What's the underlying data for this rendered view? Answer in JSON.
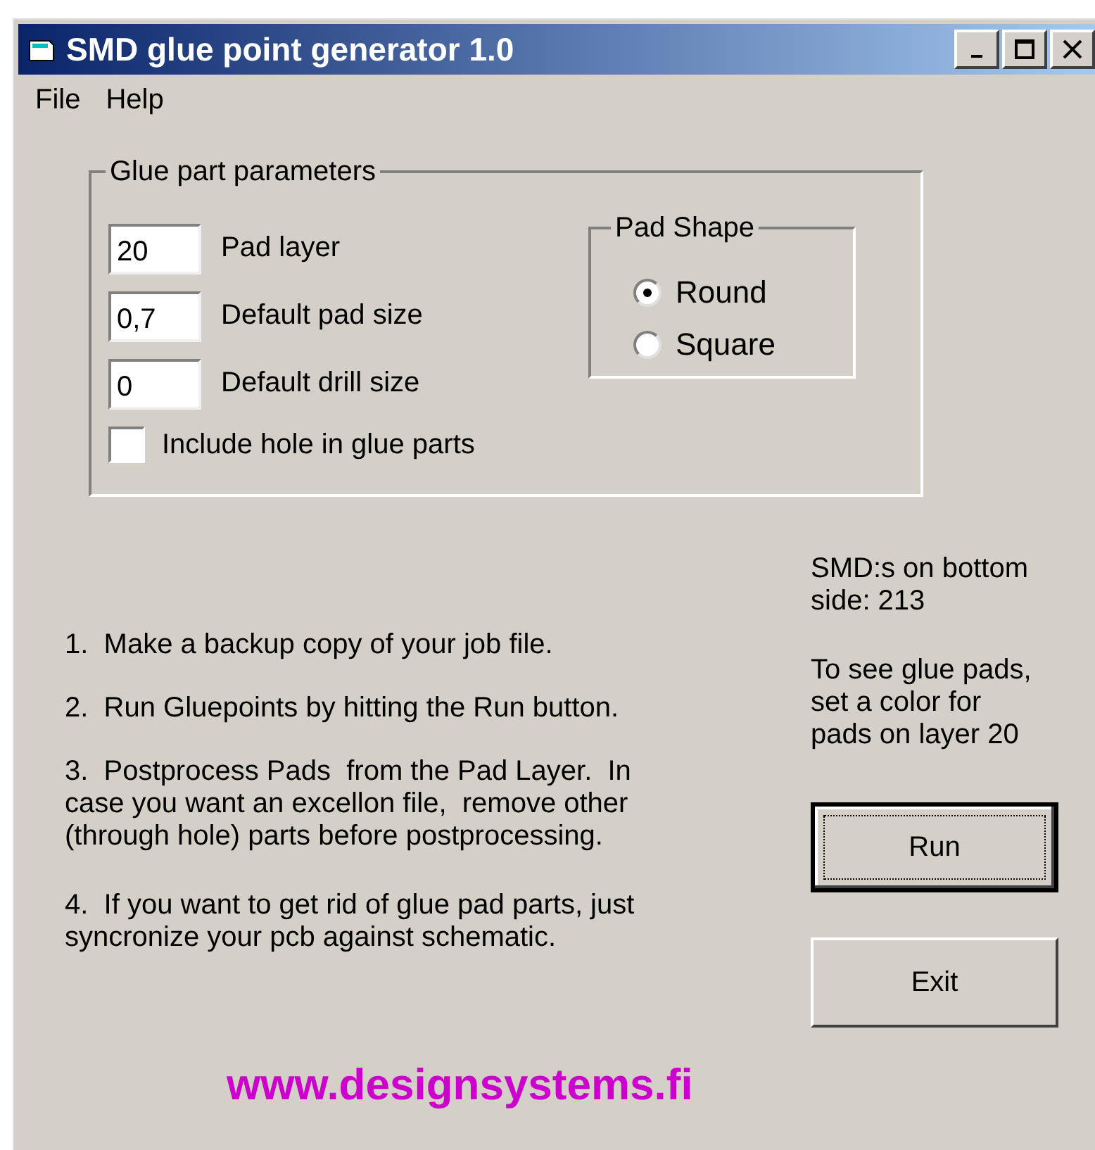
{
  "window": {
    "title": "SMD glue point generator 1.0"
  },
  "menu": [
    "File",
    "Help"
  ],
  "params": {
    "title": "Glue part parameters",
    "fields": [
      {
        "value": "20",
        "label": "Pad layer"
      },
      {
        "value": "0,7",
        "label": "Default pad size"
      },
      {
        "value": "0",
        "label": "Default drill size"
      }
    ],
    "checkbox": {
      "label": "Include hole in glue parts",
      "checked": false
    },
    "pad_shape": {
      "title": "Pad Shape",
      "options": [
        {
          "label": "Round",
          "selected": true
        },
        {
          "label": "Square",
          "selected": false
        }
      ]
    }
  },
  "instructions": [
    "1.  Make a backup copy of your job file.",
    "2.  Run Gluepoints by hitting the Run button.",
    "3.  Postprocess Pads  from the Pad Layer.  In case you want an excellon file,  remove other (through hole) parts before postprocessing.",
    "4.  If you want to get rid of glue pad parts, just syncronize your pcb against schematic."
  ],
  "status": [
    "SMD:s on bottom side: 213",
    "To see glue pads, set a color for pads on layer 20"
  ],
  "buttons": [
    {
      "label": "Run",
      "default": true
    },
    {
      "label": "Exit",
      "default": false
    }
  ],
  "link": "www.designsystems.fi"
}
